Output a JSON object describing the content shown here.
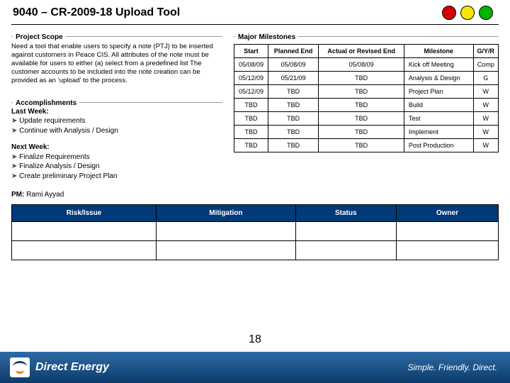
{
  "title": "9040 – CR-2009-18 Upload Tool",
  "lights": {
    "red": "#d40000",
    "yellow": "#f7e600",
    "green": "#00b400"
  },
  "project_scope": {
    "label": "Project Scope",
    "text": "Need a tool that enable users to specify a note (PTJ) to be inserted against customers in Peace CIS. All attributes of the note must be available for users to either (a) select from a predefined list The customer accounts to be included into the note creation can be provided as an ‘upload’ to the process."
  },
  "accomplishments": {
    "label": "Accomplishments",
    "last_week_hdr": "Last Week:",
    "last_week": [
      "Update requirements",
      "Continue with Analysis / Design"
    ],
    "next_week_hdr": "Next Week:",
    "next_week": [
      "Finalize Requirements",
      "Finalize Analysis / Design",
      "Create preliminary Project Plan"
    ]
  },
  "milestones": {
    "label": "Major Milestones",
    "headers": [
      "Start",
      "Planned End",
      "Actual or Revised End",
      "Milestone",
      "G/Y/R"
    ],
    "rows": [
      {
        "start": "05/08/09",
        "pend": "05/08/09",
        "aend": "05/08/09",
        "name": "Kick off Meeting",
        "gyr": "Comp"
      },
      {
        "start": "05/12/09",
        "pend": "05/21/09",
        "aend": "TBD",
        "name": "Analysis & Design",
        "gyr": "G"
      },
      {
        "start": "05/12/09",
        "pend": "TBD",
        "aend": "TBD",
        "name": "Project Plan",
        "gyr": "W"
      },
      {
        "start": "TBD",
        "pend": "TBD",
        "aend": "TBD",
        "name": "Build",
        "gyr": "W"
      },
      {
        "start": "TBD",
        "pend": "TBD",
        "aend": "TBD",
        "name": "Test",
        "gyr": "W"
      },
      {
        "start": "TBD",
        "pend": "TBD",
        "aend": "TBD",
        "name": "Implement",
        "gyr": "W"
      },
      {
        "start": "TBD",
        "pend": "TBD",
        "aend": "TBD",
        "name": "Post Production",
        "gyr": "W"
      }
    ]
  },
  "pm": {
    "label": "PM:",
    "name": "Rami Ayyad"
  },
  "risk_headers": [
    "Risk/Issue",
    "Mitigation",
    "Status",
    "Owner"
  ],
  "footer": {
    "brand": "Direct Energy",
    "tagline": "Simple. Friendly. Direct."
  },
  "page_number": "18"
}
